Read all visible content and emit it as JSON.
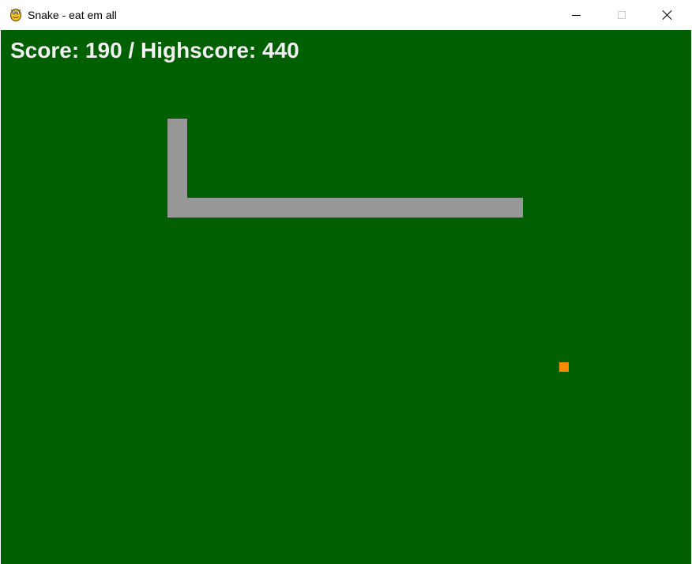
{
  "window": {
    "title": "Snake - eat em all"
  },
  "icons": {
    "app": "pygame-snake-icon",
    "minimize": "minimize-icon",
    "maximize": "maximize-icon",
    "close": "close-icon"
  },
  "game": {
    "score_text": "Score: 190 / Highscore: 440",
    "score": 190,
    "highscore": 440
  },
  "colors": {
    "background": "#005f00",
    "snake": "#979797",
    "food": "#ff8c00",
    "score_text": "#f2f2f2"
  }
}
